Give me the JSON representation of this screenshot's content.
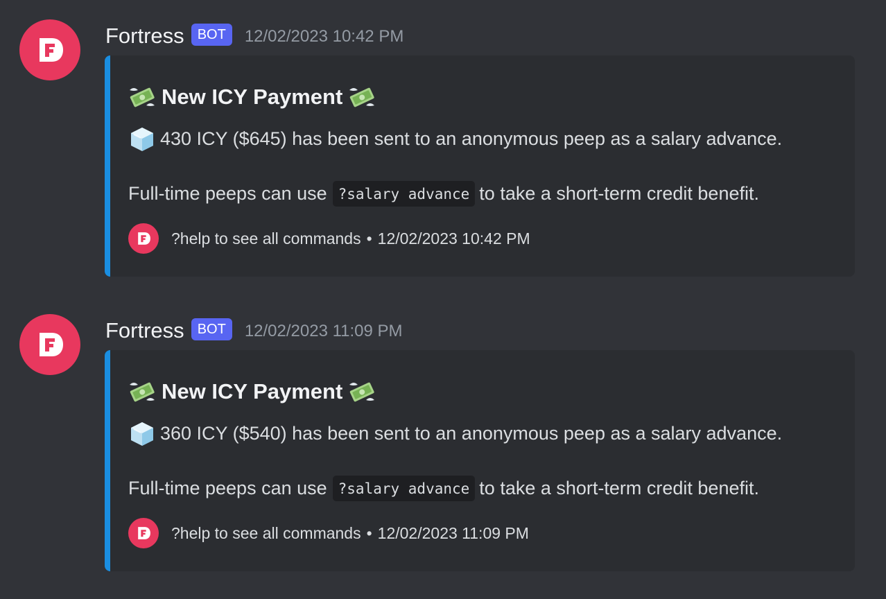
{
  "messages": [
    {
      "username": "Fortress",
      "bot_tag": "BOT",
      "timestamp": "12/02/2023 10:42 PM",
      "embed": {
        "title": "New ICY Payment",
        "line1_text": "430 ICY ($645) has been sent to an anonymous peep as a salary advance.",
        "line2_prefix": "Full-time peeps can use",
        "line2_code": "?salary advance",
        "line2_suffix": "to take a short-term credit benefit.",
        "footer_text": "?help to see all commands",
        "footer_separator": "•",
        "footer_timestamp": "12/02/2023 10:42 PM",
        "accent_color": "#1a8ee1"
      }
    },
    {
      "username": "Fortress",
      "bot_tag": "BOT",
      "timestamp": "12/02/2023 11:09 PM",
      "embed": {
        "title": "New ICY Payment",
        "line1_text": "360 ICY ($540) has been sent to an anonymous peep as a salary advance.",
        "line2_prefix": "Full-time peeps can use",
        "line2_code": "?salary advance",
        "line2_suffix": "to take a short-term credit benefit.",
        "footer_text": "?help to see all commands",
        "footer_separator": "•",
        "footer_timestamp": "12/02/2023 11:09 PM",
        "accent_color": "#1a8ee1"
      }
    }
  ],
  "icons": {
    "avatar": "fortress-logo-icon",
    "title_emoji": "money-with-wings-icon",
    "line_emoji": "ice-cube-icon"
  },
  "colors": {
    "background": "#313338",
    "embed_background": "#2b2d31",
    "brand": "#e8385e",
    "bot_tag": "#5865f2"
  }
}
